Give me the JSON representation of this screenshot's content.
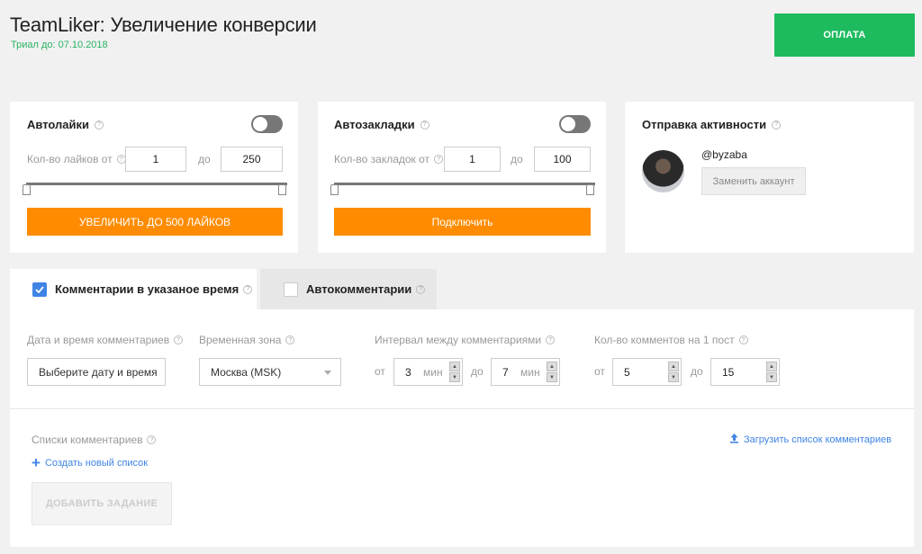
{
  "header": {
    "title": "TeamLiker: Увеличение конверсии",
    "trial": "Триал до: 07.10.2018",
    "pay_button": "ОПЛАТА"
  },
  "autolikes": {
    "title": "Автолайки",
    "count_label": "Кол-во лайков от",
    "from": "1",
    "to_label": "до",
    "to": "250",
    "button": "УВЕЛИЧИТЬ ДО 500 ЛАЙКОВ",
    "enabled": false
  },
  "autobookmarks": {
    "title": "Автозакладки",
    "count_label": "Кол-во закладок от",
    "from": "1",
    "to_label": "до",
    "to": "100",
    "button": "Подключить",
    "enabled": false
  },
  "activity": {
    "title": "Отправка активности",
    "username": "@byzaba",
    "replace_button": "Заменить аккаунт"
  },
  "tabs": [
    {
      "label": "Комментарии в указаное время",
      "checked": true,
      "active": true
    },
    {
      "label": "Автокомментарии",
      "checked": false,
      "active": false
    }
  ],
  "comments": {
    "datetime_label": "Дата и время комментариев",
    "datetime_placeholder": "Выберите дату и время",
    "timezone_label": "Временная зона",
    "timezone_value": "Москва (MSK)",
    "interval_label": "Интервал между комментариями",
    "interval_from_label": "от",
    "interval_from": "3",
    "interval_unit": "мин",
    "interval_to_label": "до",
    "interval_to": "7",
    "count_label": "Кол-во комментов на 1 пост",
    "count_from_label": "от",
    "count_from": "5",
    "count_to_label": "до",
    "count_to": "15",
    "lists_label": "Списки комментариев",
    "create_list": "Создать новый список",
    "upload_list": "Загрузить список комментариев",
    "add_task": "ДОБАВИТЬ ЗАДАНИЕ"
  },
  "colors": {
    "green": "#1dbb5e",
    "orange": "#ff8c00",
    "blue": "#3f84e5"
  }
}
